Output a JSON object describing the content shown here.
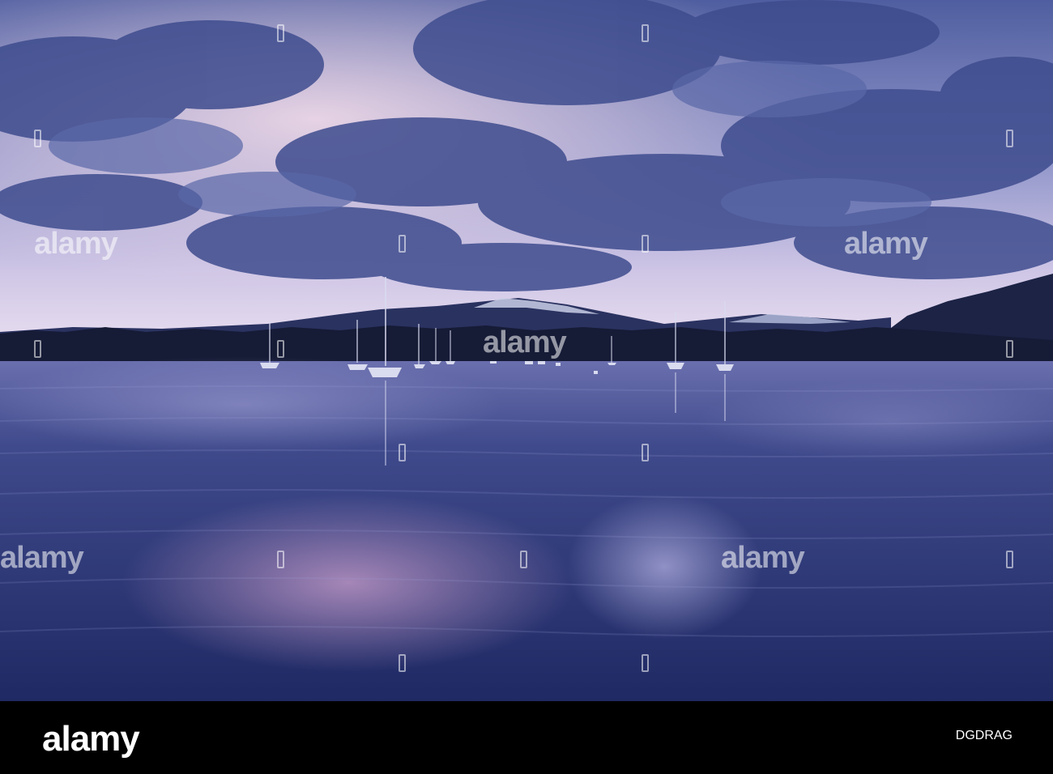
{
  "image": {
    "description_colors": {
      "sky_top": "#5a6aa8",
      "sky_glow": "#d7c3e2",
      "cloud": "#41508f",
      "water": "#2f3a7a",
      "reflection": "#8e7ab8",
      "hills": "#1b2140",
      "snow": "#c9cfe6"
    }
  },
  "watermark": {
    "text": "alamy"
  },
  "footer": {
    "logo": "alamy",
    "image_id": "DGDRAG"
  }
}
